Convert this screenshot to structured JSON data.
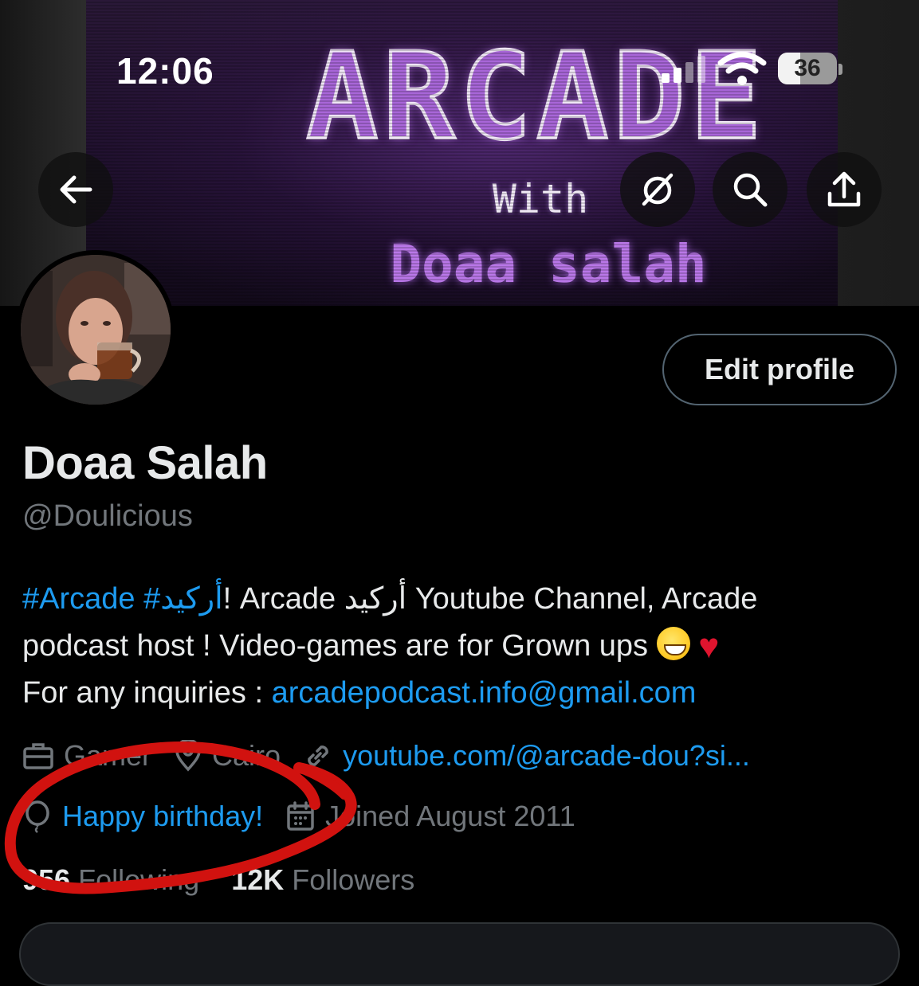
{
  "status_bar": {
    "time": "12:06",
    "battery": "36"
  },
  "banner": {
    "title": "ARCADE",
    "subtitle": "With",
    "name": "Doaa salah"
  },
  "header_actions": {
    "back_icon": "arrow-left-icon",
    "grok_icon": "slashed-circle-icon",
    "search_icon": "search-icon",
    "share_icon": "share-icon"
  },
  "profile": {
    "edit_label": "Edit profile",
    "display_name": "Doaa Salah",
    "handle": "@Doulicious",
    "bio": {
      "hashtag_1": "#Arcade",
      "hashtag_2": "#أركيد",
      "line1_rest": "! Arcade أركيد Youtube Channel, Arcade",
      "line2": "podcast host ! Video-games are for Grown ups",
      "line3_prefix": "For any inquiries : ",
      "email": "arcadepodcast.info@gmail.com"
    },
    "meta": {
      "job": "Gamer",
      "location": "Cairo",
      "website": "youtube.com/@arcade-dou?si...",
      "birthday": "Happy birthday!",
      "joined": "Joined August 2011"
    },
    "stats": {
      "following_count": "956",
      "following_label": "Following",
      "followers_count": "12K",
      "followers_label": "Followers"
    }
  },
  "colors": {
    "link": "#1d9bf0",
    "annotation": "#d1120f"
  }
}
